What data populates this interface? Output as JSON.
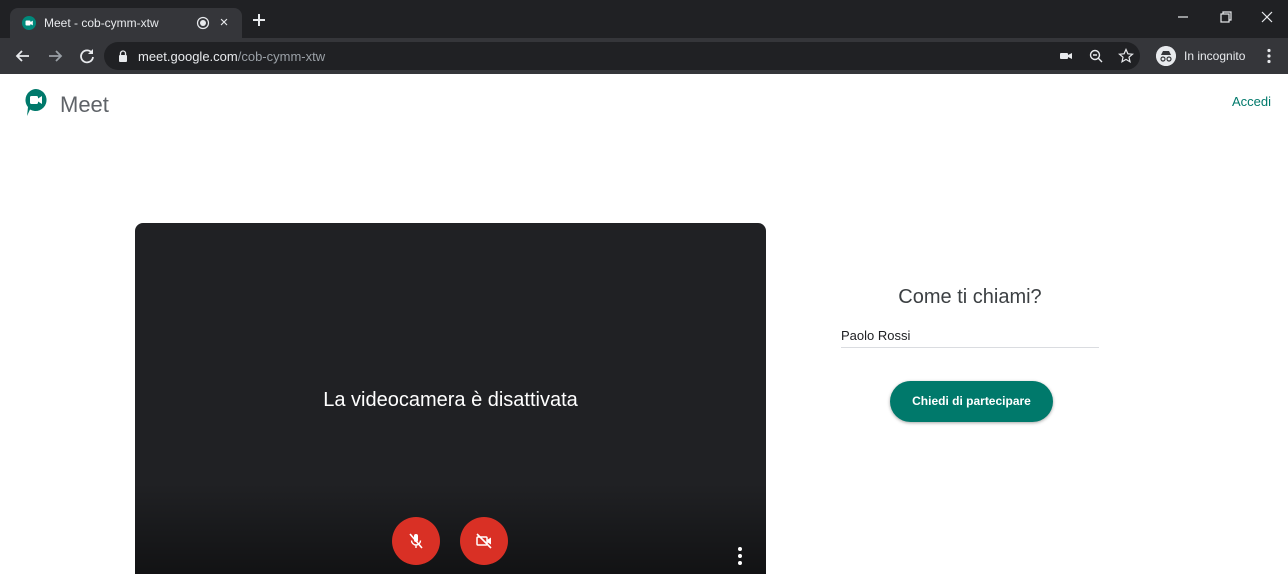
{
  "browser": {
    "tab_title": "Meet - cob-cymm-xtw",
    "url_host": "meet.google.com",
    "url_path": "/cob-cymm-xtw",
    "incognito_label": "In incognito",
    "icons": [
      "meet-favicon",
      "audio-playing-icon",
      "close-icon",
      "plus-icon",
      "minimize-icon",
      "restore-icon",
      "back-icon",
      "forward-icon",
      "reload-icon",
      "lock-icon",
      "camera-icon",
      "zoom-icon",
      "star-icon",
      "incognito-icon",
      "kebab-icon"
    ],
    "colors": {
      "frame": "#202124",
      "toolbar": "#35363a",
      "text": "#e8eaed"
    }
  },
  "header": {
    "app_name": "Meet",
    "signin_label": "Accedi"
  },
  "preview": {
    "message": "La videocamera è disattivata",
    "mic_state": "off",
    "camera_state": "off"
  },
  "join": {
    "prompt": "Come ti chiami?",
    "name_value": "Paolo Rossi",
    "ask_button": "Chiedi di partecipare"
  },
  "colors": {
    "accent": "#00796b",
    "danger": "#d93025",
    "preview_bg": "#202124"
  }
}
